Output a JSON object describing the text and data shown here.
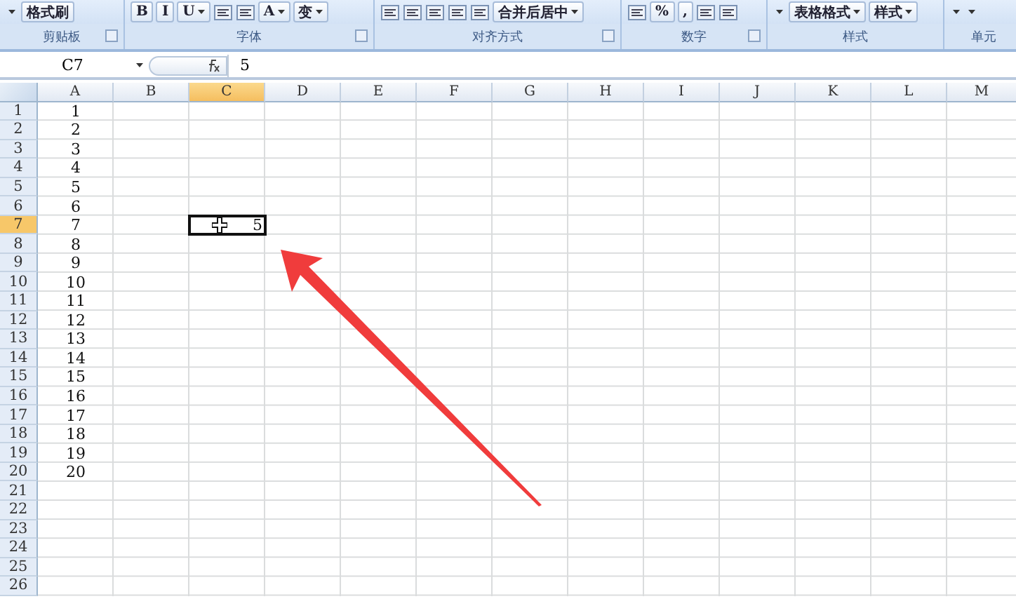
{
  "ribbon": {
    "groups": [
      {
        "label": "剪贴板",
        "launcher": true,
        "items": [
          {
            "kind": "caret"
          },
          {
            "kind": "text",
            "label": "格式刷"
          }
        ]
      },
      {
        "label": "字体",
        "launcher": true,
        "items": [
          {
            "kind": "text",
            "label": "B"
          },
          {
            "kind": "text",
            "label": "I"
          },
          {
            "kind": "dropdown",
            "label": "U"
          },
          {
            "kind": "icon"
          },
          {
            "kind": "icon"
          },
          {
            "kind": "dropdown",
            "label": "A"
          },
          {
            "kind": "dropdown",
            "label": "变"
          }
        ]
      },
      {
        "label": "对齐方式",
        "launcher": true,
        "items": [
          {
            "kind": "icon"
          },
          {
            "kind": "icon"
          },
          {
            "kind": "icon"
          },
          {
            "kind": "icon"
          },
          {
            "kind": "icon"
          },
          {
            "kind": "dropdown",
            "label": "合并后居中"
          }
        ]
      },
      {
        "label": "数字",
        "launcher": true,
        "items": [
          {
            "kind": "icon"
          },
          {
            "kind": "text",
            "label": "%"
          },
          {
            "kind": "text",
            "label": ","
          },
          {
            "kind": "icon"
          },
          {
            "kind": "icon"
          }
        ]
      },
      {
        "label": "样式",
        "launcher": false,
        "items": [
          {
            "kind": "caret"
          },
          {
            "kind": "dropdown",
            "label": "表格格式"
          },
          {
            "kind": "dropdown",
            "label": "样式"
          }
        ]
      },
      {
        "label": "单元",
        "launcher": false,
        "items": [
          {
            "kind": "caret"
          },
          {
            "kind": "caret"
          }
        ]
      }
    ]
  },
  "formula_bar": {
    "name_box": "C7",
    "formula": "5"
  },
  "sheet": {
    "columns": [
      {
        "label": "A",
        "selected": false
      },
      {
        "label": "B",
        "selected": false
      },
      {
        "label": "C",
        "selected": true
      },
      {
        "label": "D",
        "selected": false
      },
      {
        "label": "E",
        "selected": false
      },
      {
        "label": "F",
        "selected": false
      },
      {
        "label": "G",
        "selected": false
      },
      {
        "label": "H",
        "selected": false
      },
      {
        "label": "I",
        "selected": false
      },
      {
        "label": "J",
        "selected": false
      },
      {
        "label": "K",
        "selected": false
      },
      {
        "label": "L",
        "selected": false
      },
      {
        "label": "M",
        "selected": false
      }
    ],
    "rows": [
      {
        "label": "1",
        "selected": false,
        "cells": {
          "A": "1"
        }
      },
      {
        "label": "2",
        "selected": false,
        "cells": {
          "A": "2"
        }
      },
      {
        "label": "3",
        "selected": false,
        "cells": {
          "A": "3"
        }
      },
      {
        "label": "4",
        "selected": false,
        "cells": {
          "A": "4"
        }
      },
      {
        "label": "5",
        "selected": false,
        "cells": {
          "A": "5"
        }
      },
      {
        "label": "6",
        "selected": false,
        "cells": {
          "A": "6"
        }
      },
      {
        "label": "7",
        "selected": true,
        "cells": {
          "A": "7",
          "C": "5"
        }
      },
      {
        "label": "8",
        "selected": false,
        "cells": {
          "A": "8"
        }
      },
      {
        "label": "9",
        "selected": false,
        "cells": {
          "A": "9"
        }
      },
      {
        "label": "10",
        "selected": false,
        "cells": {
          "A": "10"
        }
      },
      {
        "label": "11",
        "selected": false,
        "cells": {
          "A": "11"
        }
      },
      {
        "label": "12",
        "selected": false,
        "cells": {
          "A": "12"
        }
      },
      {
        "label": "13",
        "selected": false,
        "cells": {
          "A": "13"
        }
      },
      {
        "label": "14",
        "selected": false,
        "cells": {
          "A": "14"
        }
      },
      {
        "label": "15",
        "selected": false,
        "cells": {
          "A": "15"
        }
      },
      {
        "label": "16",
        "selected": false,
        "cells": {
          "A": "16"
        }
      },
      {
        "label": "17",
        "selected": false,
        "cells": {
          "A": "17"
        }
      },
      {
        "label": "18",
        "selected": false,
        "cells": {
          "A": "18"
        }
      },
      {
        "label": "19",
        "selected": false,
        "cells": {
          "A": "19"
        }
      },
      {
        "label": "20",
        "selected": false,
        "cells": {
          "A": "20"
        }
      },
      {
        "label": "21",
        "selected": false,
        "cells": {}
      },
      {
        "label": "22",
        "selected": false,
        "cells": {}
      },
      {
        "label": "23",
        "selected": false,
        "cells": {}
      },
      {
        "label": "24",
        "selected": false,
        "cells": {}
      },
      {
        "label": "25",
        "selected": false,
        "cells": {}
      },
      {
        "label": "26",
        "selected": false,
        "cells": {}
      }
    ]
  }
}
